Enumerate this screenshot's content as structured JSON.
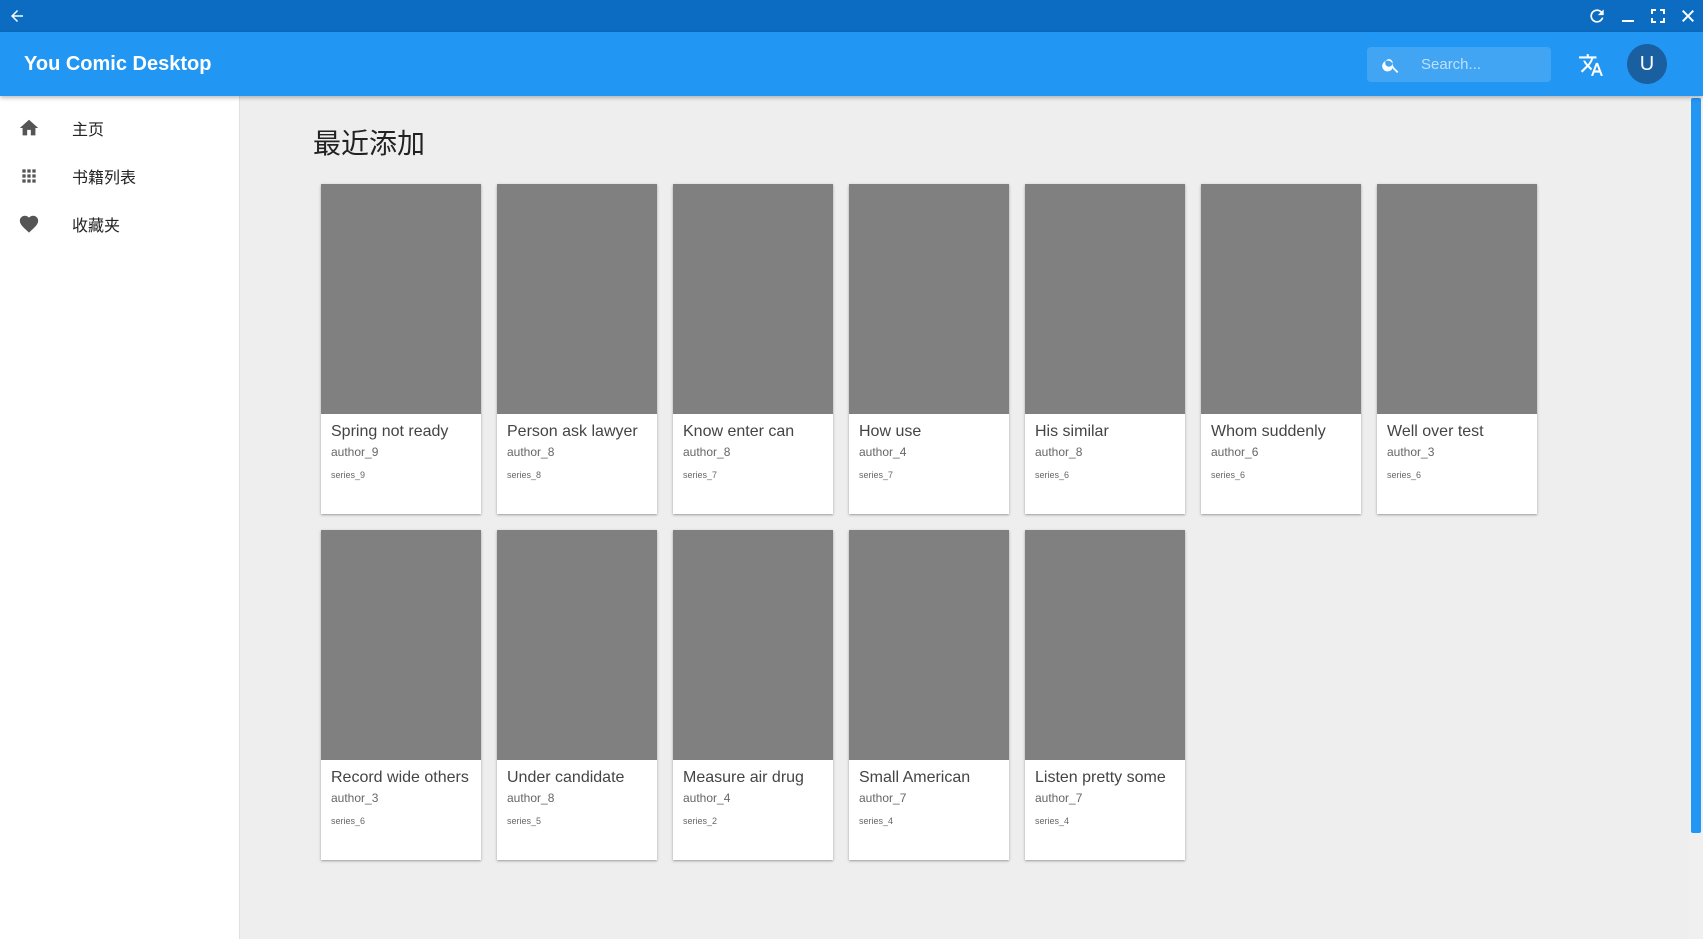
{
  "window": {
    "controls": [
      "back-arrow-icon",
      "refresh-icon",
      "minimize-icon",
      "fullscreen-icon",
      "close-icon"
    ]
  },
  "appbar": {
    "title": "You Comic Desktop",
    "search_placeholder": "Search...",
    "avatar_letter": "U",
    "accent": "#2196f3"
  },
  "sidebar": {
    "items": [
      {
        "label": "主页",
        "icon": "home-icon"
      },
      {
        "label": "书籍列表",
        "icon": "grid-icon"
      },
      {
        "label": "收藏夹",
        "icon": "heart-icon"
      }
    ]
  },
  "main": {
    "section_title": "最近添加",
    "books": [
      {
        "title": "Spring not ready",
        "author": "author_9",
        "series": "series_9"
      },
      {
        "title": "Person ask lawyer",
        "author": "author_8",
        "series": "series_8"
      },
      {
        "title": "Know enter can",
        "author": "author_8",
        "series": "series_7"
      },
      {
        "title": "How use",
        "author": "author_4",
        "series": "series_7"
      },
      {
        "title": "His similar",
        "author": "author_8",
        "series": "series_6"
      },
      {
        "title": "Whom suddenly",
        "author": "author_6",
        "series": "series_6"
      },
      {
        "title": "Well over test",
        "author": "author_3",
        "series": "series_6"
      },
      {
        "title": "Record wide others",
        "author": "author_3",
        "series": "series_6"
      },
      {
        "title": "Under candidate",
        "author": "author_8",
        "series": "series_5"
      },
      {
        "title": "Measure air drug",
        "author": "author_4",
        "series": "series_2"
      },
      {
        "title": "Small American",
        "author": "author_7",
        "series": "series_4"
      },
      {
        "title": "Listen pretty some",
        "author": "author_7",
        "series": "series_4"
      }
    ]
  }
}
